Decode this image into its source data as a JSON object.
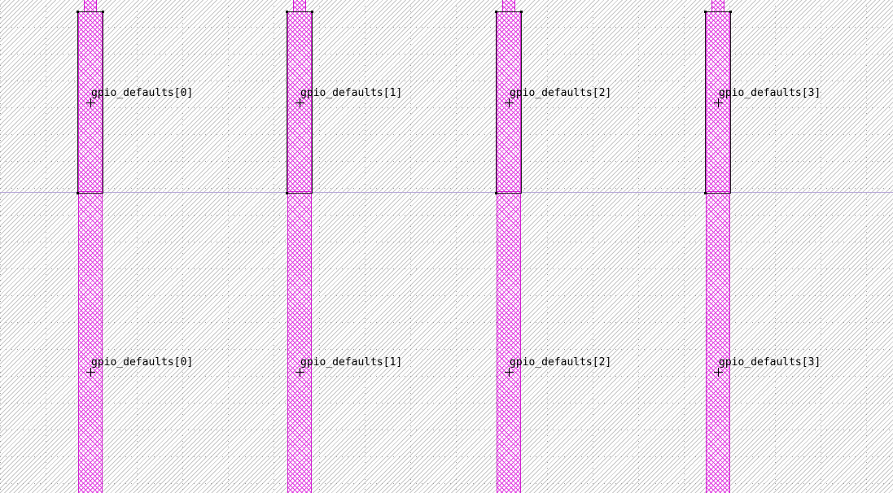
{
  "layout_view": {
    "pins_upper": [
      {
        "name": "gpio_defaults[0]"
      },
      {
        "name": "gpio_defaults[1]"
      },
      {
        "name": "gpio_defaults[2]"
      },
      {
        "name": "gpio_defaults[3]"
      }
    ],
    "pins_lower": [
      {
        "name": "gpio_defaults[0]"
      },
      {
        "name": "gpio_defaults[1]"
      },
      {
        "name": "gpio_defaults[2]"
      },
      {
        "name": "gpio_defaults[3]"
      }
    ],
    "colors": {
      "pin_layer": "#e040e0",
      "pin_outline": "#222222",
      "background_hatch": "#969696",
      "boundary": "#b7a8d8"
    }
  }
}
